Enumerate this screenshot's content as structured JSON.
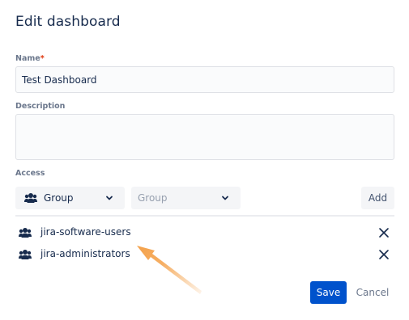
{
  "dialog": {
    "title": "Edit dashboard"
  },
  "form": {
    "name_label": "Name",
    "required_marker": "*",
    "name_value": "Test Dashboard",
    "description_label": "Description",
    "description_value": "",
    "access_label": "Access"
  },
  "access": {
    "type_select": {
      "icon": "group-icon",
      "selected": "Group"
    },
    "group_select": {
      "placeholder": "Group"
    },
    "add_label": "Add"
  },
  "shares": [
    {
      "icon": "group-icon",
      "name": "jira-software-users",
      "remove_icon": "close-icon"
    },
    {
      "icon": "group-icon",
      "name": "jira-administrators",
      "remove_icon": "close-icon"
    }
  ],
  "footer": {
    "save_label": "Save",
    "cancel_label": "Cancel"
  },
  "colors": {
    "primary": "#0052cc",
    "annotation_arrow": "#f4a14a",
    "required": "#de350b"
  }
}
